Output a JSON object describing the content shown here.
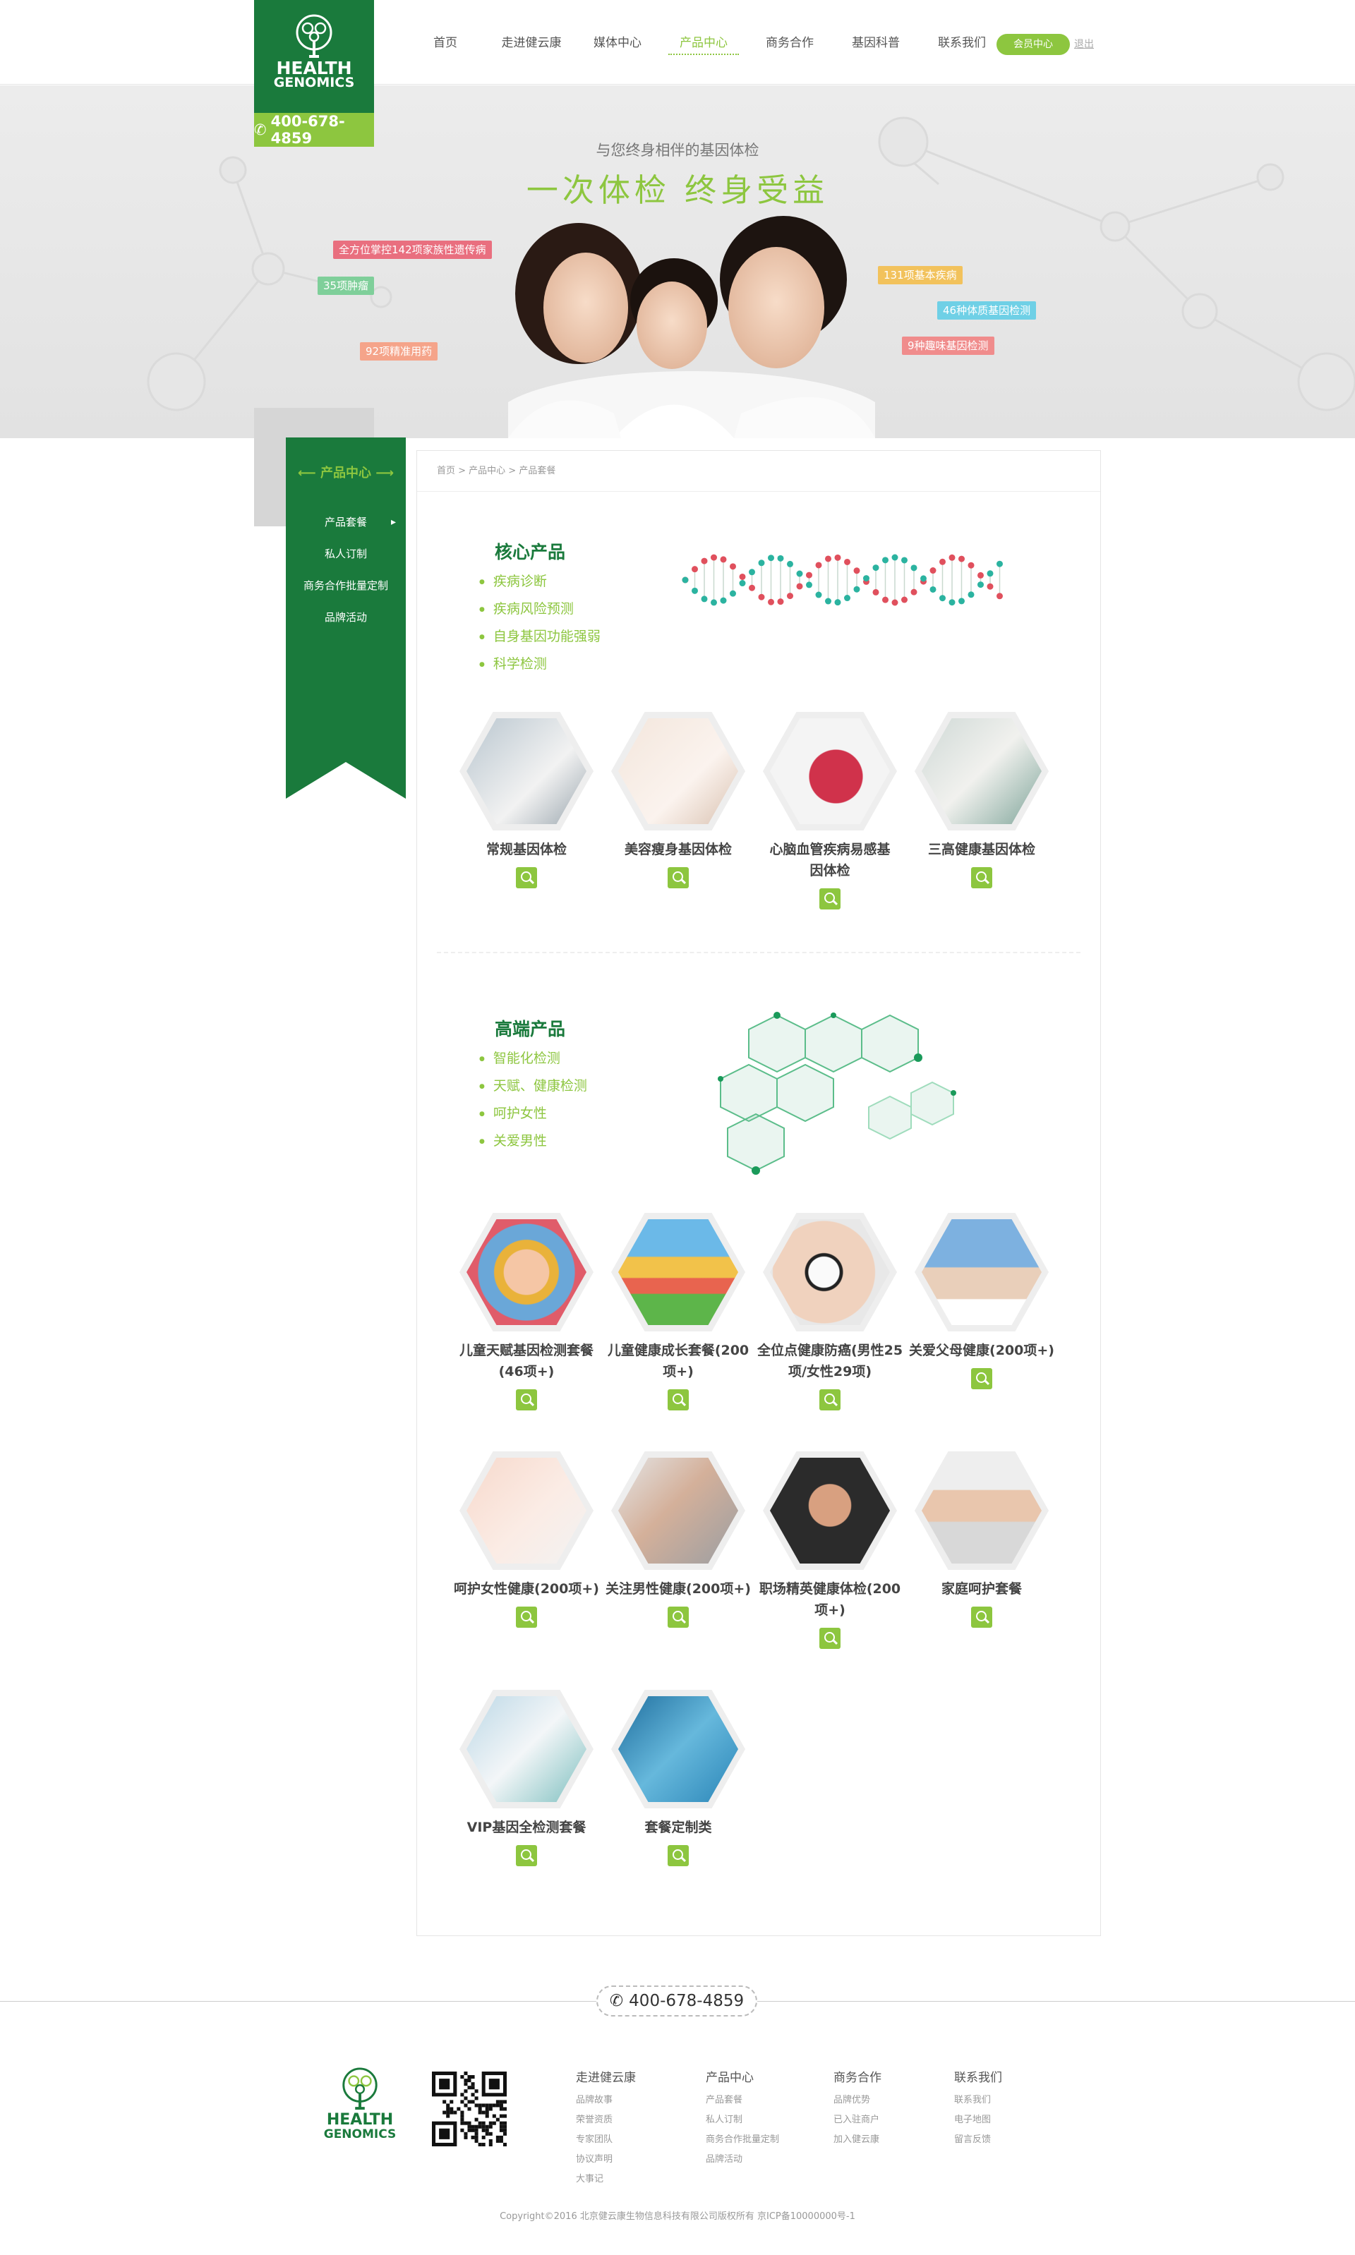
{
  "header": {
    "logo_line1": "HEALTH",
    "logo_line2": "GENOMICS",
    "phone": "400-678-4859",
    "nav": [
      "首页",
      "走进健云康",
      "媒体中心",
      "产品中心",
      "商务合作",
      "基因科普",
      "联系我们"
    ],
    "member": "会员中心",
    "logout": "退出"
  },
  "banner": {
    "subtitle": "与您终身相伴的基因体检",
    "title": "一次体检  终身受益",
    "tags": [
      {
        "text": "全方位掌控142项家族性遗传病",
        "color": "#e96f7f"
      },
      {
        "text": "35项肿瘤",
        "color": "#7fcf9a"
      },
      {
        "text": "92项精准用药",
        "color": "#f5a48a"
      },
      {
        "text": "131项基本疾病",
        "color": "#f2c25c"
      },
      {
        "text": "46种体质基因检测",
        "color": "#6fd0e6"
      },
      {
        "text": "9种趣味基因检测",
        "color": "#f08c8c"
      }
    ]
  },
  "sidebar": {
    "title": "产品中心",
    "items": [
      "产品套餐",
      "私人订制",
      "商务合作批量定制",
      "品牌活动"
    ]
  },
  "breadcrumb": "首页 > 产品中心 > 产品套餐",
  "core": {
    "title": "核心产品",
    "features": [
      "疾病诊断",
      "疾病风险预测",
      "自身基因功能强弱",
      "科学检测"
    ],
    "products": [
      {
        "name": "常规基因体检"
      },
      {
        "name": "美容瘦身基因体检"
      },
      {
        "name": "心脑血管疾病易感基因体检"
      },
      {
        "name": "三高健康基因体检"
      }
    ]
  },
  "high": {
    "title": "高端产品",
    "features": [
      "智能化检测",
      "天赋、健康检测",
      "呵护女性",
      "关爱男性"
    ],
    "products": [
      {
        "name": "儿童天赋基因检测套餐(46项+)"
      },
      {
        "name": "儿童健康成长套餐(200项+)"
      },
      {
        "name": "全位点健康防癌(男性25项/女性29项)"
      },
      {
        "name": "关爱父母健康(200项+)"
      },
      {
        "name": "呵护女性健康(200项+)"
      },
      {
        "name": "关注男性健康(200项+)"
      },
      {
        "name": "职场精英健康体检(200项+)"
      },
      {
        "name": "家庭呵护套餐"
      },
      {
        "name": "VIP基因全检测套餐"
      },
      {
        "name": "套餐定制类"
      }
    ]
  },
  "footer": {
    "phone": "400-678-4859",
    "logo_line1": "HEALTH",
    "logo_line2": "GENOMICS",
    "columns": [
      {
        "title": "走进健云康",
        "links": [
          "品牌故事",
          "荣誉资质",
          "专家团队",
          "协议声明",
          "大事记"
        ]
      },
      {
        "title": "产品中心",
        "links": [
          "产品套餐",
          "私人订制",
          "商务合作批量定制",
          "品牌活动"
        ]
      },
      {
        "title": "商务合作",
        "links": [
          "品牌优势",
          "已入驻商户",
          "加入健云康"
        ]
      },
      {
        "title": "联系我们",
        "links": [
          "联系我们",
          "电子地图",
          "留言反馈"
        ]
      }
    ],
    "copyright": "Copyright©2016 北京健云康生物信息科技有限公司版权所有  京ICP备10000000号-1"
  },
  "colors": {
    "primary": "#1a7a3c",
    "accent": "#8dc63f"
  }
}
